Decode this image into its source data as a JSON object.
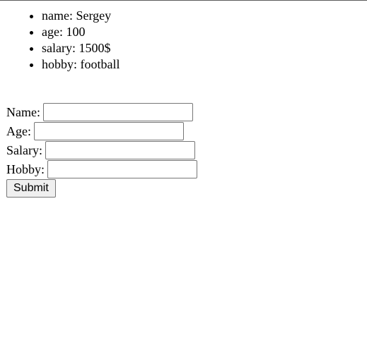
{
  "profile": {
    "items": [
      {
        "key": "name",
        "value": "Sergey"
      },
      {
        "key": "age",
        "value": "100"
      },
      {
        "key": "salary",
        "value": "1500$"
      },
      {
        "key": "hobby",
        "value": "football"
      }
    ]
  },
  "form": {
    "name_label": "Name:",
    "age_label": "Age:",
    "salary_label": "Salary:",
    "hobby_label": "Hobby:",
    "name_value": "",
    "age_value": "",
    "salary_value": "",
    "hobby_value": "",
    "submit_label": "Submit"
  }
}
